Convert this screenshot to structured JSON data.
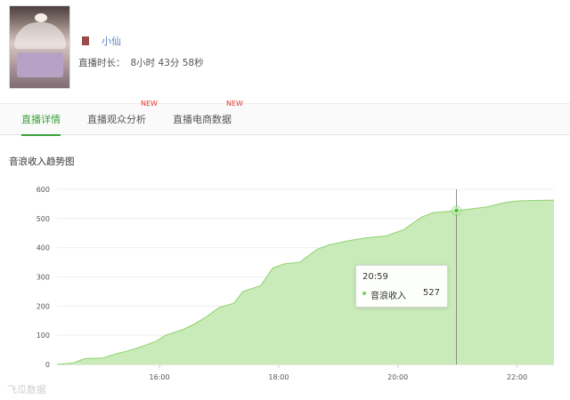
{
  "profile": {
    "name": "小仙",
    "duration_label": "直播时长：",
    "duration_value": "8小时 43分 58秒"
  },
  "tabs": [
    {
      "label": "直播详情",
      "active": true,
      "badge": ""
    },
    {
      "label": "直播观众分析",
      "active": false,
      "badge": "NEW"
    },
    {
      "label": "直播电商数据",
      "active": false,
      "badge": "NEW"
    }
  ],
  "chart_title": "音浪收入趋势图",
  "tooltip": {
    "time": "20:59",
    "series": "音浪收入",
    "value": "527"
  },
  "watermark": "飞瓜数据",
  "colors": {
    "accent": "#3aa03a",
    "area_fill": "#c9ebb9",
    "area_line": "#8fd26e",
    "new_badge": "#e3382e"
  },
  "chart_data": {
    "type": "area",
    "title": "音浪收入趋势图",
    "xlabel": "",
    "ylabel": "",
    "x_ticks": [
      "16:00",
      "18:00",
      "20:00",
      "22:00"
    ],
    "y_ticks": [
      0,
      100,
      200,
      300,
      400,
      500,
      600
    ],
    "ylim": [
      0,
      600
    ],
    "xlim_hours": [
      14.28,
      22.62
    ],
    "grid": true,
    "series": [
      {
        "name": "音浪收入",
        "points": [
          [
            14.28,
            0
          ],
          [
            14.55,
            5
          ],
          [
            14.75,
            20
          ],
          [
            15.05,
            22
          ],
          [
            15.25,
            35
          ],
          [
            15.5,
            48
          ],
          [
            15.75,
            65
          ],
          [
            15.95,
            80
          ],
          [
            16.1,
            100
          ],
          [
            16.4,
            120
          ],
          [
            16.6,
            140
          ],
          [
            16.8,
            165
          ],
          [
            17.0,
            195
          ],
          [
            17.25,
            210
          ],
          [
            17.4,
            250
          ],
          [
            17.7,
            270
          ],
          [
            17.9,
            330
          ],
          [
            18.1,
            345
          ],
          [
            18.35,
            350
          ],
          [
            18.65,
            395
          ],
          [
            18.85,
            410
          ],
          [
            19.2,
            425
          ],
          [
            19.5,
            435
          ],
          [
            19.8,
            440
          ],
          [
            20.1,
            462
          ],
          [
            20.4,
            505
          ],
          [
            20.59,
            520
          ],
          [
            20.98,
            527
          ],
          [
            21.2,
            532
          ],
          [
            21.5,
            540
          ],
          [
            21.8,
            555
          ],
          [
            22.0,
            560
          ],
          [
            22.3,
            562
          ],
          [
            22.62,
            563
          ]
        ]
      }
    ],
    "highlight": {
      "x": "20:59",
      "y": 527
    }
  }
}
